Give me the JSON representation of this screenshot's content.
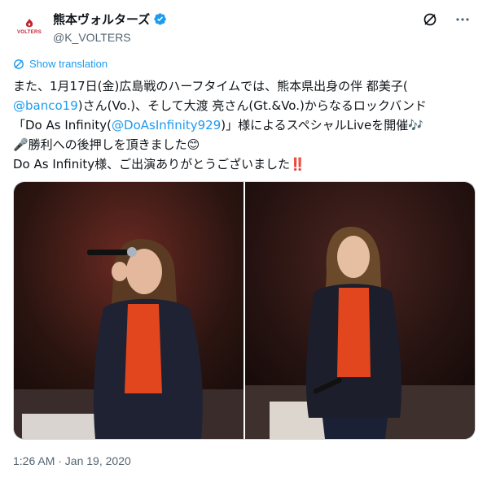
{
  "account": {
    "display_name": "熊本ヴォルターズ",
    "handle": "@K_VOLTERS",
    "avatar_brand": "VOLTERS",
    "verified_icon": "verified-badge-icon"
  },
  "actions": {
    "grok_icon": "grok-icon",
    "more_icon": "more-icon"
  },
  "translate_label": "Show translation",
  "tweet": {
    "line1": "また、1月17日(金)広島戦のハーフタイムでは、熊本県出身の伴 都美子(",
    "mention1": "@banco19",
    "line2": ")さん(Vo.)、そして大渡 亮さん(Gt.&Vo.)からなるロックバンド",
    "line3a": "「Do As Infinity(",
    "mention2": "@DoAsInfinity929",
    "line3b": ")」様によるスペシャルLiveを開催🎶",
    "line4": "🎤勝利への後押しを頂きました😊",
    "line5": "Do As Infinity様、ご出演ありがとうございました‼️"
  },
  "timestamp": "1:26 AM · Jan 19, 2020",
  "colors": {
    "link": "#1d9bf0",
    "muted": "#536471",
    "brand_red": "#c0242f"
  }
}
